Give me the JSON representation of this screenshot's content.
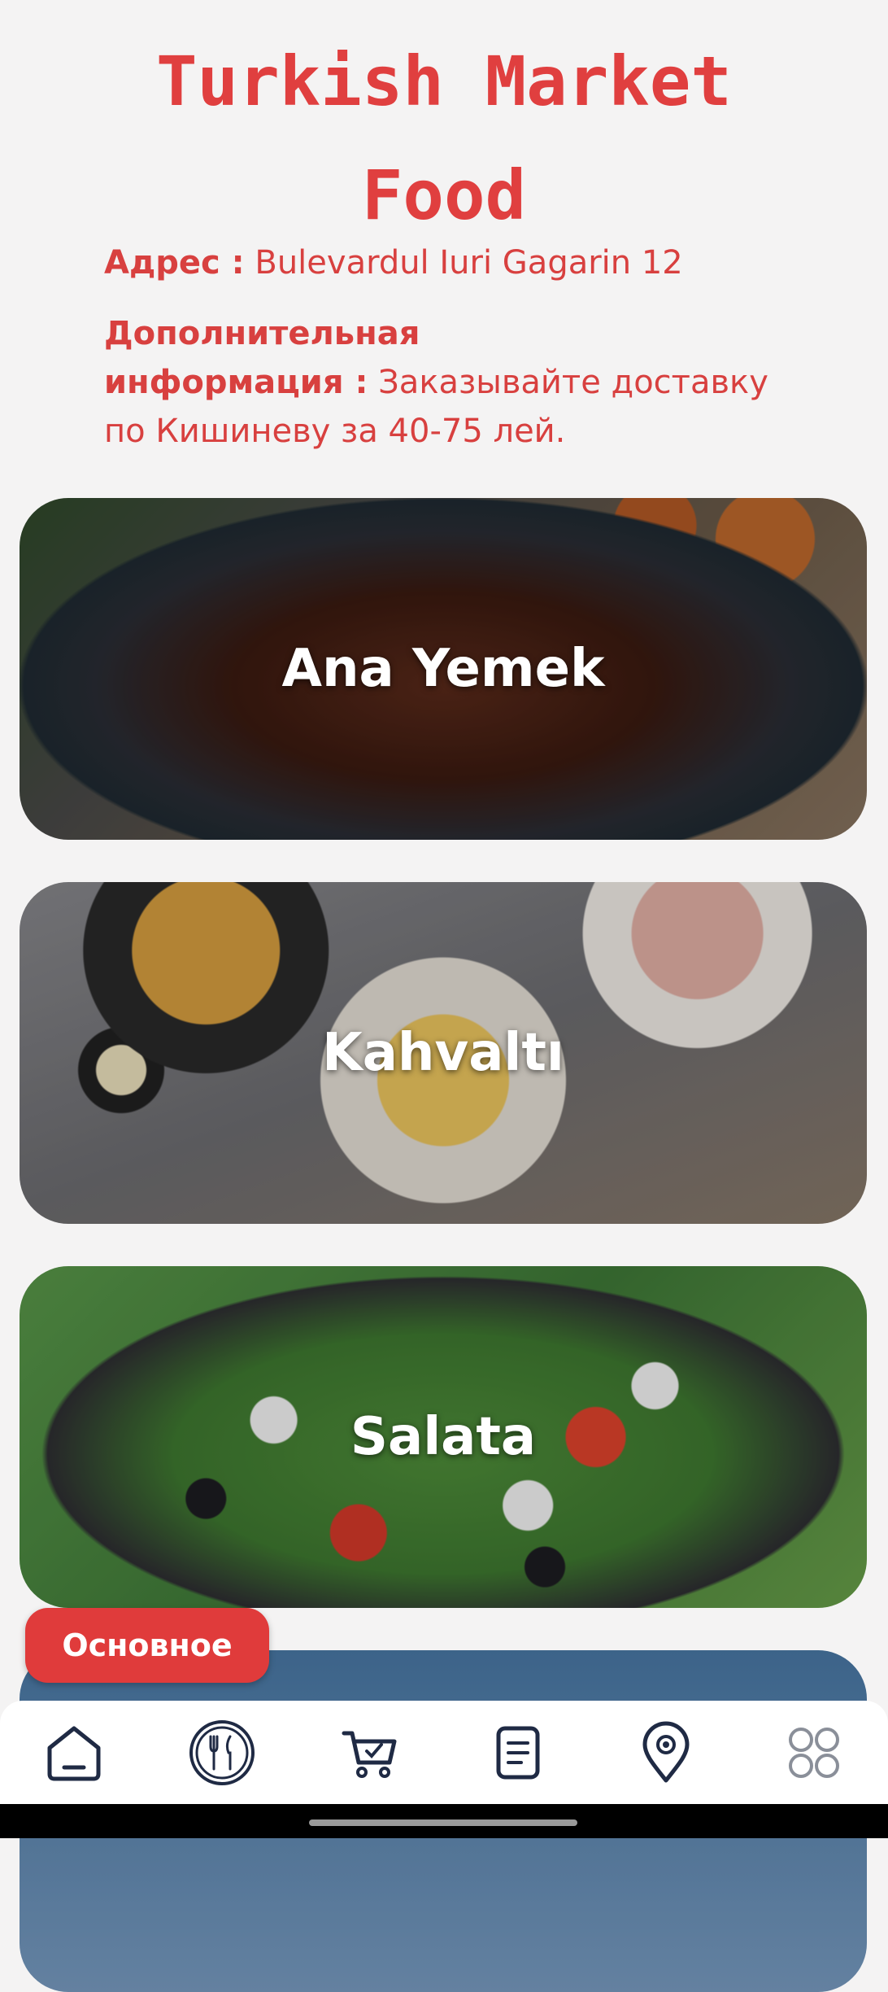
{
  "restaurant": {
    "title_line1": "Turkish Market",
    "title_line2": "Food",
    "address_label": "Адрес :",
    "address_value": "Bulevardul Iuri Gagarin 12",
    "extra_label_line1": "Дополнительная",
    "extra_label_line2": "информация :",
    "extra_value": "Заказывайте доставку по Кишиневу за 40-75 лей."
  },
  "categories": [
    {
      "label": "Ana Yemek"
    },
    {
      "label": "Kahvaltı"
    },
    {
      "label": "Salata"
    },
    {
      "label": ""
    }
  ],
  "chip": {
    "label": "Основное"
  },
  "tabbar": {
    "items": [
      {
        "icon": "home-icon",
        "active": true
      },
      {
        "icon": "restaurant-icon"
      },
      {
        "icon": "cart-icon"
      },
      {
        "icon": "orders-icon"
      },
      {
        "icon": "location-icon"
      },
      {
        "icon": "more-grid-icon"
      }
    ]
  },
  "colors": {
    "accent": "#e03b3b",
    "nav_icon": "#1f2a44",
    "background": "#f4f3f3"
  }
}
